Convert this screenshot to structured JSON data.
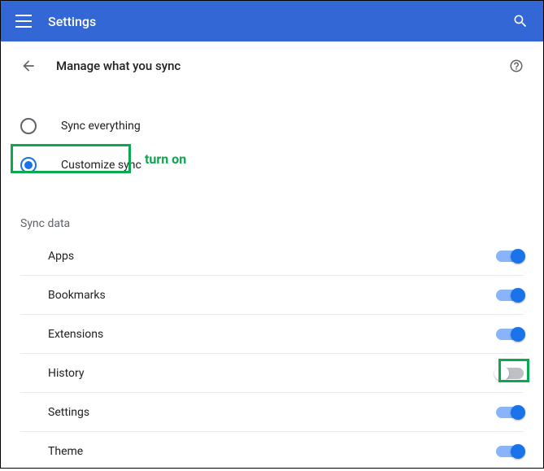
{
  "header": {
    "title": "Settings"
  },
  "subheader": {
    "title": "Manage what you sync"
  },
  "radios": {
    "sync_everything": {
      "label": "Sync everything",
      "selected": false
    },
    "customize_sync": {
      "label": "Customize sync",
      "selected": true
    }
  },
  "annotation": {
    "turn_on": "turn on"
  },
  "section": {
    "title": "Sync data"
  },
  "toggles": [
    {
      "label": "Apps",
      "on": true
    },
    {
      "label": "Bookmarks",
      "on": true
    },
    {
      "label": "Extensions",
      "on": true
    },
    {
      "label": "History",
      "on": false
    },
    {
      "label": "Settings",
      "on": true
    },
    {
      "label": "Theme",
      "on": true
    }
  ],
  "colors": {
    "primary": "#1a73e8",
    "header_bg": "#3367d6",
    "annotation_green": "#0aa84f"
  }
}
